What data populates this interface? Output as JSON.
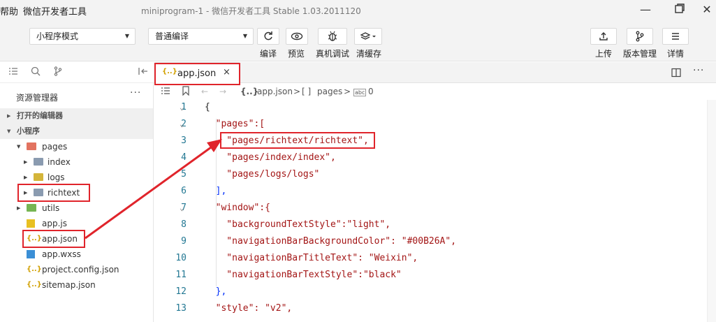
{
  "menubar": {
    "help": "帮助",
    "app_name": "微信开发者工具",
    "window_title": "miniprogram-1 - 微信开发者工具 Stable 1.03.2011120"
  },
  "toolbar": {
    "mode_select": "小程序模式",
    "compile_select": "普通编译",
    "compile_label": "编译",
    "preview_label": "预览",
    "remote_debug_label": "真机调试",
    "clear_cache_label": "清缓存",
    "upload_label": "上传",
    "version_label": "版本管理",
    "details_label": "详情"
  },
  "sidebar": {
    "title": "资源管理器",
    "more": "···",
    "open_editors": "打开的编辑器",
    "project": "小程序",
    "tree": [
      {
        "name": "pages"
      },
      {
        "name": "index"
      },
      {
        "name": "logs"
      },
      {
        "name": "richtext"
      },
      {
        "name": "utils"
      },
      {
        "name": "app.js"
      },
      {
        "name": "app.json"
      },
      {
        "name": "app.wxss"
      },
      {
        "name": "project.config.json"
      },
      {
        "name": "sitemap.json"
      }
    ]
  },
  "tabs": [
    {
      "label": "app.json",
      "close": "×"
    }
  ],
  "breadcrumb": {
    "file": "app.json",
    "sep": ">",
    "array_icon": "[ ]",
    "key": "pages",
    "item_icon": "abc",
    "index": "0"
  },
  "editor": {
    "line_numbers": [
      "1",
      "2",
      "3",
      "4",
      "5",
      "6",
      "7",
      "8",
      "9",
      "10",
      "11",
      "12",
      "13"
    ],
    "lines": [
      "{",
      "  \"pages\":[",
      "    \"pages/richtext/richtext\",",
      "    \"pages/index/index\",",
      "    \"pages/logs/logs\"",
      "  ],",
      "  \"window\":{",
      "    \"backgroundTextStyle\":\"light\",",
      "    \"navigationBarBackgroundColor\": \"#00B26A\",",
      "    \"navigationBarTitleText\": \"Weixin\",",
      "    \"navigationBarTextStyle\":\"black\"",
      "  },",
      "  \"style\": \"v2\","
    ]
  },
  "colors": {
    "annotation_red": "#e0242b",
    "string": "#a31515",
    "line_number": "#237893"
  }
}
